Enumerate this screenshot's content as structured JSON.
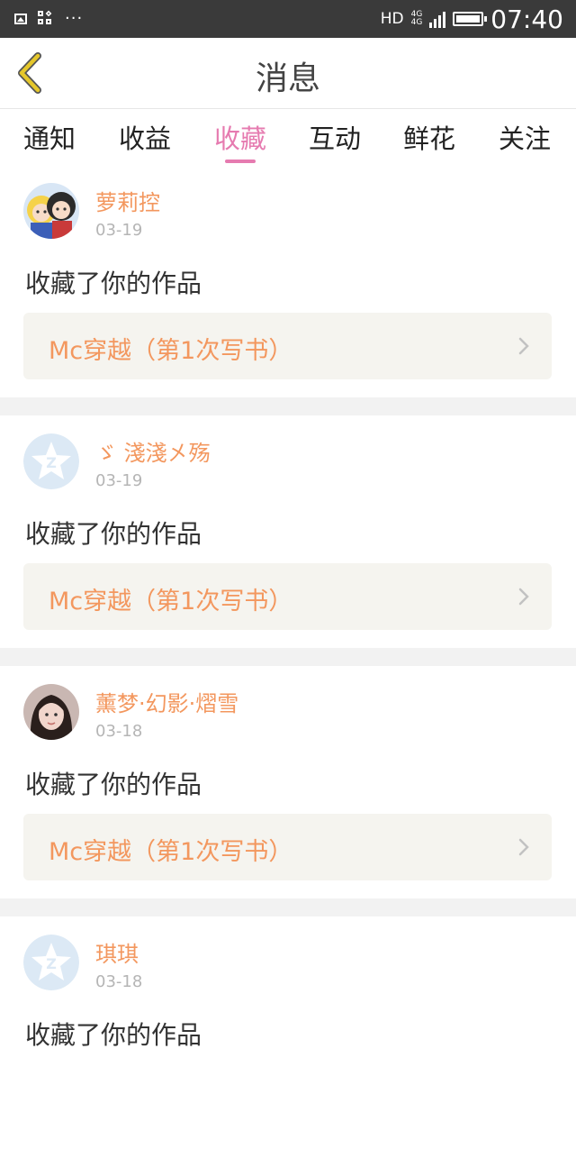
{
  "status_bar": {
    "left_icons": [
      "image-icon",
      "apps-grid-icon",
      "more-dots-icon"
    ],
    "more_text": "···",
    "hd": "HD",
    "network": [
      "4G",
      "4G"
    ],
    "time": "07:40"
  },
  "header": {
    "title": "消息",
    "back_icon": "chevron-left-icon",
    "back_color": "#e5c72b"
  },
  "tabs": [
    {
      "label": "通知"
    },
    {
      "label": "收益"
    },
    {
      "label": "收藏"
    },
    {
      "label": "互动"
    },
    {
      "label": "鲜花"
    },
    {
      "label": "关注"
    }
  ],
  "active_tab": "收藏",
  "colors": {
    "accent_pink": "#e67bb0",
    "username_orange": "#f3975e",
    "work_box_bg": "#f5f4ef",
    "default_avatar_blue": "#dce9f5"
  },
  "messages": [
    {
      "username": "萝莉控",
      "date": "03-19",
      "action": "收藏了你的作品",
      "work_title": "Mc穿越（第1次写书）",
      "avatar": "anime-avatar"
    },
    {
      "username": "ゞ  淺淺㐅殇",
      "date": "03-19",
      "action": "收藏了你的作品",
      "work_title": "Mc穿越（第1次写书）",
      "avatar": "default-z-avatar"
    },
    {
      "username": "薰梦·幻影·熠雪",
      "date": "03-18",
      "action": "收藏了你的作品",
      "work_title": "Mc穿越（第1次写书）",
      "avatar": "photo-avatar"
    },
    {
      "username": "琪琪",
      "date": "03-18",
      "action": "收藏了你的作品",
      "work_title": "",
      "avatar": "default-z-avatar"
    }
  ]
}
